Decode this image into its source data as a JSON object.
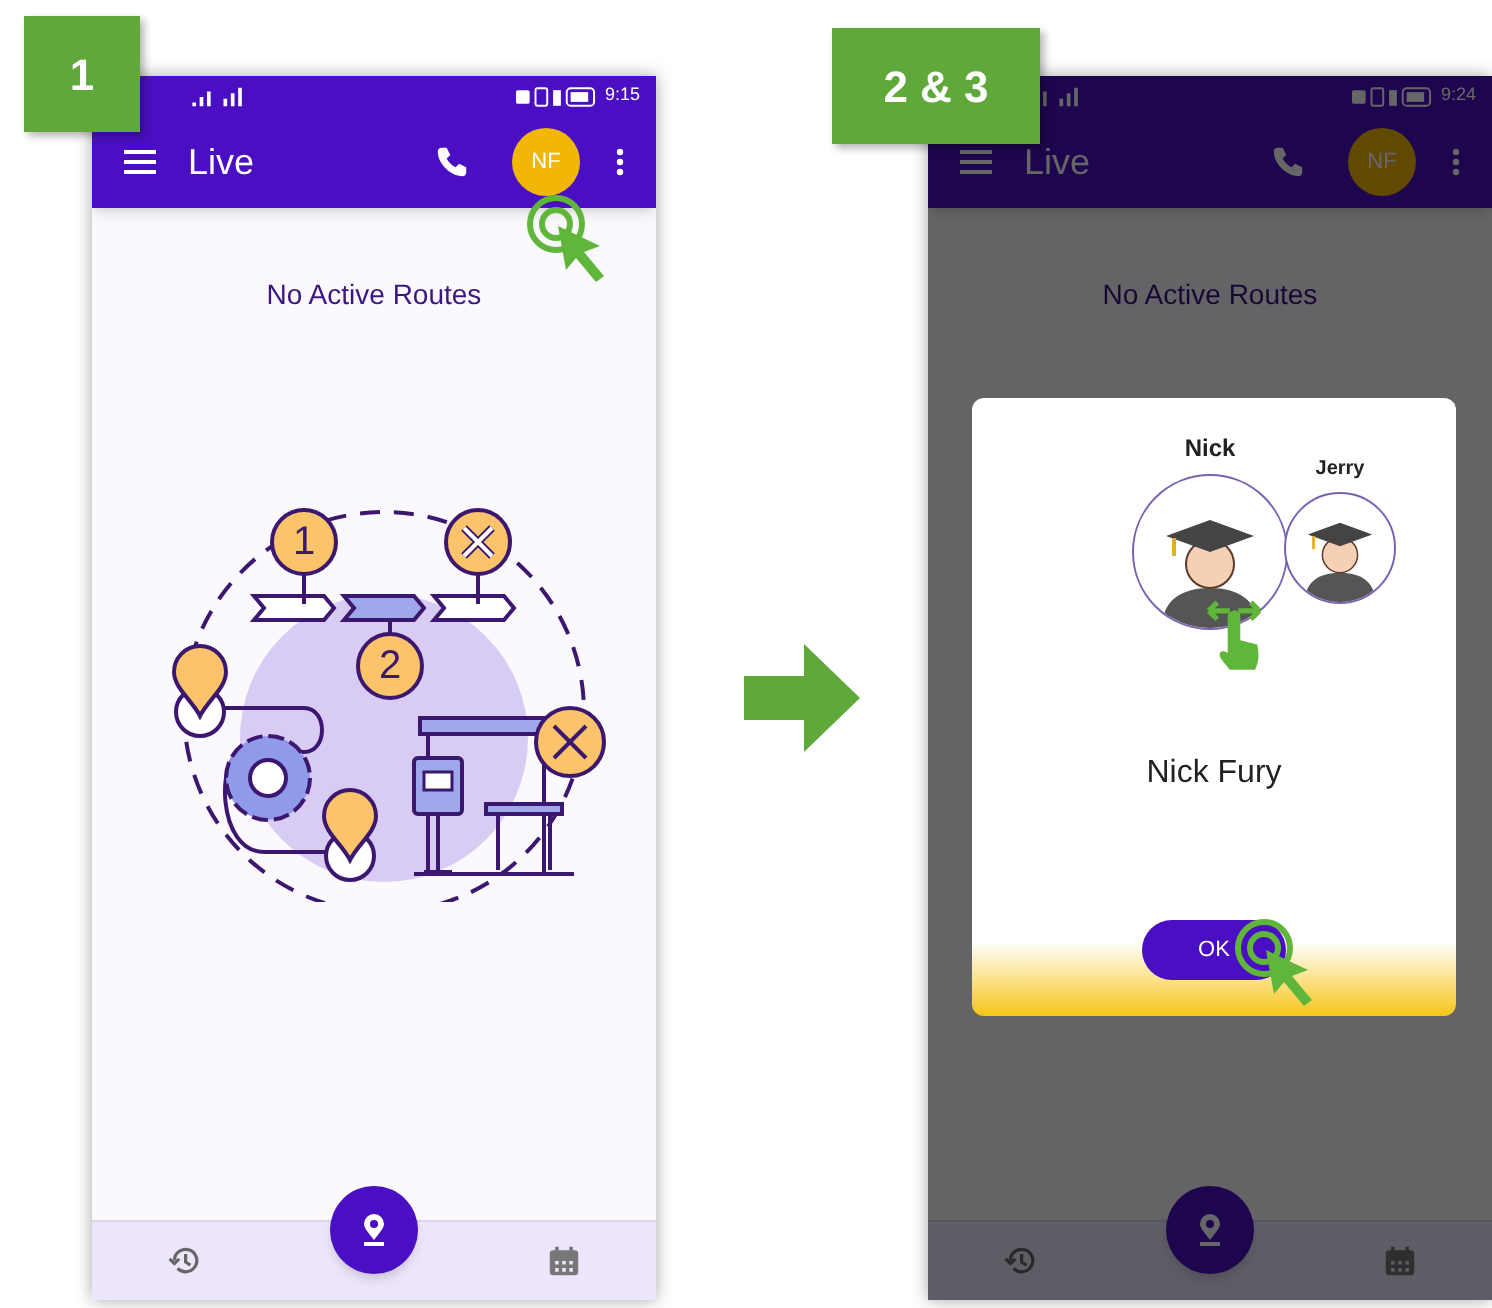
{
  "step_labels": [
    "1",
    "2 & 3"
  ],
  "screens": [
    {
      "dimmed": false,
      "status_time": "9:15",
      "app_bar": {
        "title": "Live",
        "avatar_initials": "NF"
      },
      "message": "No Active Routes",
      "tap_on_avatar": true
    },
    {
      "dimmed": true,
      "status_time": "9:24",
      "app_bar": {
        "title": "Live",
        "avatar_initials": "NF"
      },
      "message": "No Active Routes",
      "tap_on_avatar": false,
      "dialog": {
        "profiles": [
          {
            "name": "Nick",
            "selected": true
          },
          {
            "name": "Jerry",
            "selected": false
          }
        ],
        "full_name": "Nick Fury",
        "button": "OK"
      }
    }
  ],
  "illustration_numbers": [
    "1",
    "2"
  ]
}
